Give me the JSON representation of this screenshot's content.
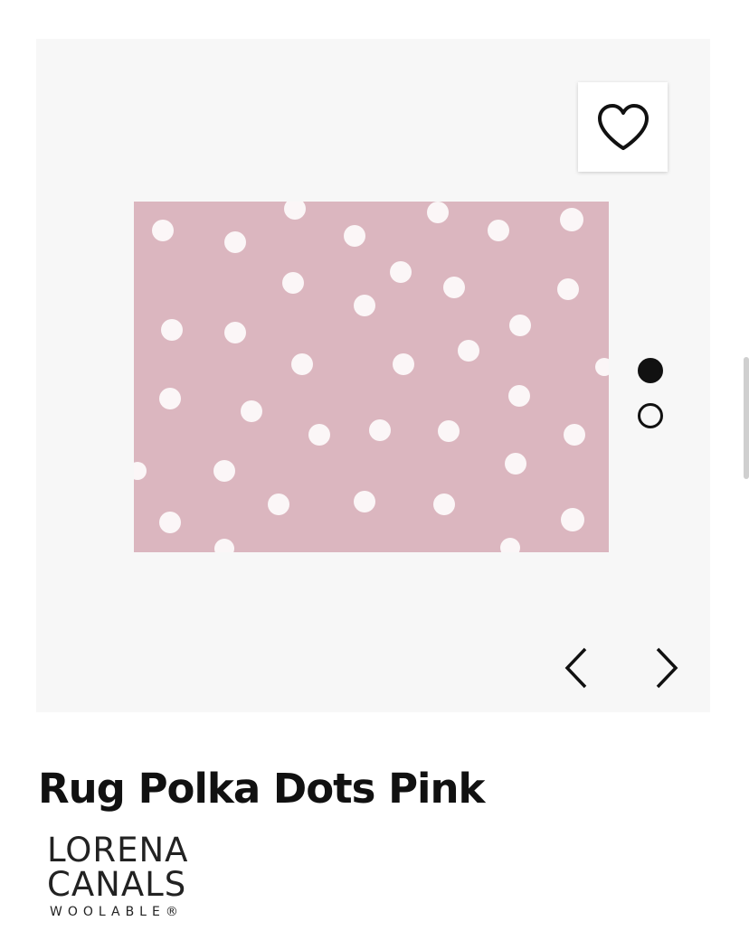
{
  "product": {
    "title": "Rug Polka Dots Pink",
    "rug_color": "#dbb6bf",
    "dot_color": "#fbf6f7"
  },
  "gallery": {
    "favorite_icon": "heart-outline-icon",
    "slide_count": 2,
    "active_slide": 1,
    "prev_icon": "chevron-left-icon",
    "next_icon": "chevron-right-icon"
  },
  "brand": {
    "line1": "LORENA",
    "line2": "CANALS",
    "line3": "WOOLABLE®"
  }
}
